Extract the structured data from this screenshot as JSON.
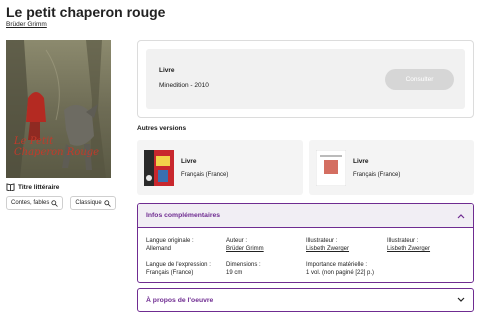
{
  "page": {
    "title": "Le petit chaperon rouge",
    "author": "Brüder Grimm"
  },
  "cover": {
    "text_line1": "Le Petit",
    "text_line2": "Chaperon Rouge"
  },
  "work_type": {
    "icon": "book-icon",
    "label": "Titre littéraire"
  },
  "tags": [
    {
      "label": "Contes, fables",
      "icon": "search-icon"
    },
    {
      "label": "Classique",
      "icon": "search-icon"
    }
  ],
  "main_card": {
    "type": "Livre",
    "publisher": "Minedition - 2010",
    "button": "Consulter"
  },
  "versions": {
    "title": "Autres versions",
    "items": [
      {
        "type": "Livre",
        "language": "Français (France)"
      },
      {
        "type": "Livre",
        "language": "Français (France)"
      }
    ]
  },
  "info": {
    "title": "Infos complémentaires",
    "fields": {
      "orig_lang_key": "Langue originale :",
      "orig_lang_val": "Allemand",
      "author_key": "Auteur :",
      "author_val": "Brüder Grimm",
      "illus1_key": "Illustrateur :",
      "illus1_val": "Lisbeth Zwerger",
      "illus2_key": "Illustrateur :",
      "illus2_val": "Lisbeth Zwerger",
      "expr_lang_key": "Langue de l'expression :",
      "expr_lang_val": "Français (France)",
      "dim_key": "Dimensions :",
      "dim_val": "19 cm",
      "mat_key": "Importance matérielle :",
      "mat_val": "1 vol. (non paginé [22] p.)"
    }
  },
  "about": {
    "title": "À propos de l'oeuvre"
  },
  "colors": {
    "accent": "#6f2c91",
    "card_bg": "#f1f1f1",
    "button_disabled": "#d6d6d6"
  }
}
